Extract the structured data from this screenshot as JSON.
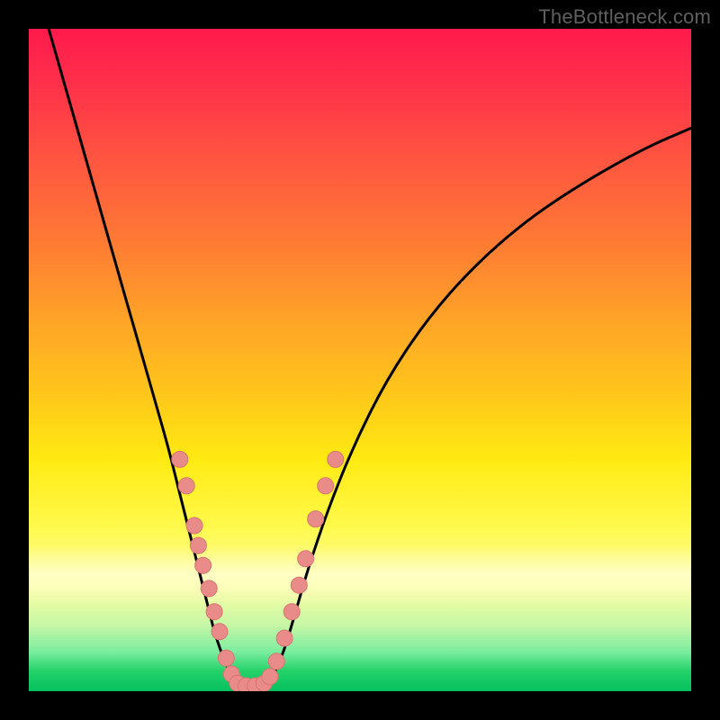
{
  "watermark": "TheBottleneck.com",
  "colors": {
    "frame": "#000000",
    "curve": "#000000",
    "marker_fill": "#e98b88",
    "marker_stroke": "#d87673"
  },
  "chart_data": {
    "type": "line",
    "title": "",
    "xlabel": "",
    "ylabel": "",
    "xlim": [
      0,
      100
    ],
    "ylim": [
      0,
      100
    ],
    "grid": false,
    "legend": false,
    "series": [
      {
        "name": "left-branch",
        "x": [
          3,
          5,
          7,
          9,
          11,
          13,
          15,
          17,
          19,
          21,
          22.5,
          24,
          25.5,
          27,
          28,
          29,
          30,
          30.8,
          31.5
        ],
        "y": [
          100,
          93,
          86,
          79,
          72,
          65,
          58,
          51,
          44,
          37,
          31,
          25,
          19,
          13,
          9,
          6,
          3.5,
          1.8,
          1
        ]
      },
      {
        "name": "valley-floor",
        "x": [
          31.5,
          33,
          34.5,
          36
        ],
        "y": [
          1,
          0.6,
          0.6,
          1
        ]
      },
      {
        "name": "right-branch",
        "x": [
          36,
          37,
          38.5,
          40,
          42,
          45,
          49,
          54,
          60,
          67,
          75,
          84,
          93,
          100
        ],
        "y": [
          1,
          2.5,
          6,
          11,
          18,
          27,
          37,
          47,
          56,
          64,
          71,
          77,
          82,
          85
        ]
      }
    ],
    "markers": [
      {
        "x": 22.8,
        "y": 35
      },
      {
        "x": 23.8,
        "y": 31
      },
      {
        "x": 25.0,
        "y": 25
      },
      {
        "x": 25.6,
        "y": 22
      },
      {
        "x": 26.3,
        "y": 19
      },
      {
        "x": 27.2,
        "y": 15.5
      },
      {
        "x": 28.0,
        "y": 12
      },
      {
        "x": 28.8,
        "y": 9
      },
      {
        "x": 29.8,
        "y": 5
      },
      {
        "x": 30.6,
        "y": 2.6
      },
      {
        "x": 31.5,
        "y": 1.2
      },
      {
        "x": 32.8,
        "y": 0.8
      },
      {
        "x": 34.2,
        "y": 0.8
      },
      {
        "x": 35.5,
        "y": 1.2
      },
      {
        "x": 36.4,
        "y": 2.2
      },
      {
        "x": 37.4,
        "y": 4.5
      },
      {
        "x": 38.6,
        "y": 8
      },
      {
        "x": 39.7,
        "y": 12
      },
      {
        "x": 40.8,
        "y": 16
      },
      {
        "x": 41.8,
        "y": 20
      },
      {
        "x": 43.3,
        "y": 26
      },
      {
        "x": 44.8,
        "y": 31
      },
      {
        "x": 46.3,
        "y": 35
      }
    ]
  }
}
